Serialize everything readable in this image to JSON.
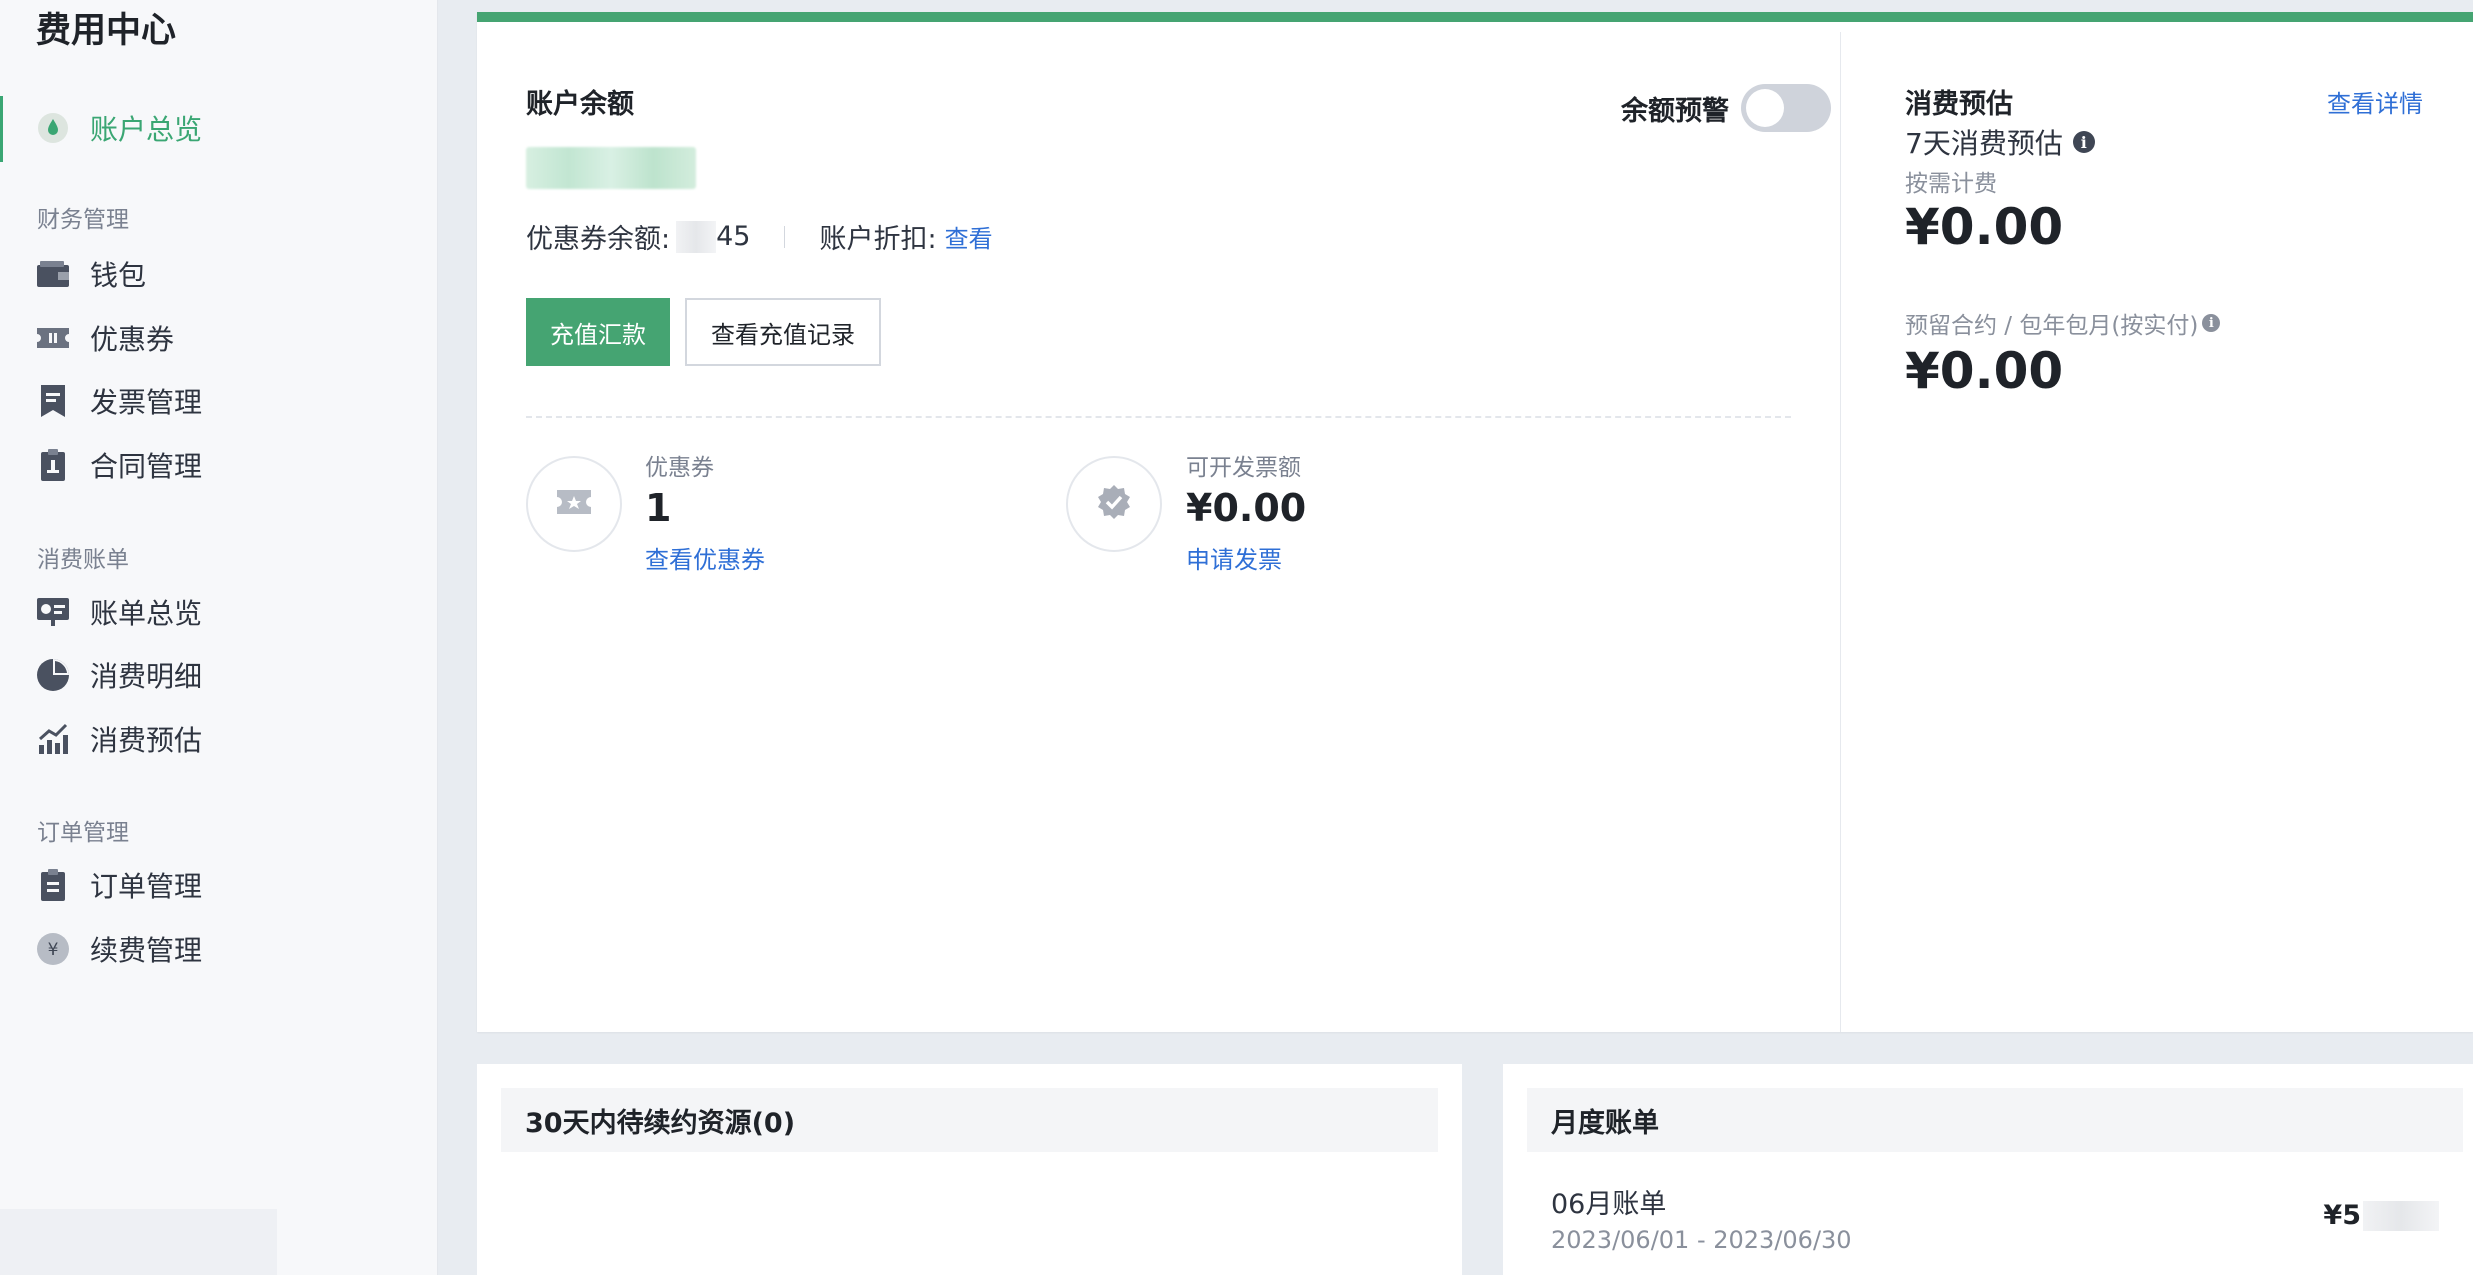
{
  "sidebar": {
    "title": "费用中心",
    "active_item": {
      "label": "账户总览",
      "icon": "droplet-icon"
    },
    "groups": [
      {
        "title": "财务管理",
        "items": [
          {
            "label": "钱包",
            "icon": "wallet-icon"
          },
          {
            "label": "优惠券",
            "icon": "ticket-icon"
          },
          {
            "label": "发票管理",
            "icon": "invoice-icon"
          },
          {
            "label": "合同管理",
            "icon": "contract-icon"
          }
        ]
      },
      {
        "title": "消费账单",
        "items": [
          {
            "label": "账单总览",
            "icon": "presentation-chart-icon"
          },
          {
            "label": "消费明细",
            "icon": "pie-chart-icon"
          },
          {
            "label": "消费预估",
            "icon": "trend-chart-icon"
          }
        ]
      },
      {
        "title": "订单管理",
        "items": [
          {
            "label": "订单管理",
            "icon": "clipboard-icon"
          },
          {
            "label": "续费管理",
            "icon": "yen-circle-icon"
          }
        ]
      }
    ]
  },
  "balance": {
    "title": "账户余额",
    "alert_label": "余额预警",
    "alert_enabled": false,
    "coupon_balance_label": "优惠券余额:",
    "coupon_balance_value_visible": "45",
    "discount_label": "账户折扣:",
    "discount_link": "查看",
    "recharge_button": "充值汇款",
    "history_button": "查看充值记录"
  },
  "stats": [
    {
      "label": "优惠券",
      "value": "1",
      "link": "查看优惠券",
      "icon": "ticket-star-icon"
    },
    {
      "label": "可开发票额",
      "value": "¥0.00",
      "link": "申请发票",
      "icon": "verified-badge-icon"
    }
  ],
  "estimate": {
    "title": "消费预估",
    "details_link": "查看详情",
    "subtitle": "7天消费预估",
    "on_demand_label": "按需计费",
    "on_demand_value": "¥0.00",
    "reserved_label": "预留合约 / 包年包月(按实付)",
    "reserved_value": "¥0.00"
  },
  "renewal": {
    "title": "30天内待续约资源(0)"
  },
  "monthly_bill": {
    "title": "月度账单",
    "bill_name": "06月账单",
    "range": "2023/06/01 - 2023/06/30",
    "amount_visible": "¥5"
  },
  "colors": {
    "accent": "#45a472",
    "link": "#2f6fd6"
  }
}
